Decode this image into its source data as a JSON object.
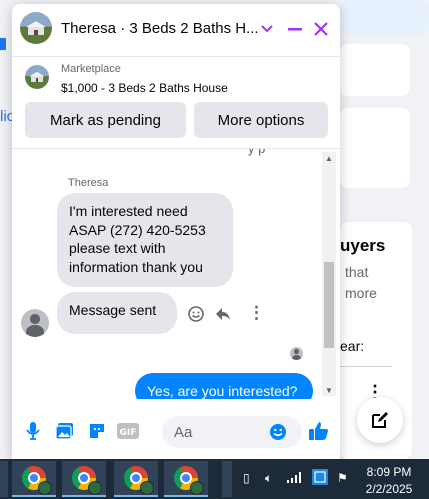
{
  "background": {
    "left_link_text": "lic",
    "right_heading": "uyers",
    "right_lines": [
      "that",
      "more"
    ],
    "right_small": "ear:",
    "colors": {
      "page_bg": "#f0f2f5",
      "link": "#1877f2"
    }
  },
  "chat": {
    "title": "Theresa · 3 Beds 2 Baths H...",
    "listing": {
      "label": "Marketplace",
      "price_title": "$1,000 - 3 Beds 2 Baths House"
    },
    "buttons": {
      "mark_pending": "Mark as pending",
      "more_options": "More options"
    },
    "partial_text": "y p",
    "messages": [
      {
        "sender": "Theresa",
        "text": "I'm interested  need ASAP (272) 420-5253 please text with information thank you"
      },
      {
        "text": "Message sent"
      },
      {
        "text": "Yes, are you interested?"
      }
    ],
    "composer": {
      "placeholder": "Aa",
      "value": ""
    },
    "colors": {
      "accent": "#a033ff",
      "outgoing_bubble": "#0084ff",
      "incoming_bubble": "#e4e6eb"
    }
  },
  "taskbar": {
    "apps": [
      "chrome",
      "chrome",
      "chrome",
      "chrome"
    ],
    "time": "8:09 PM",
    "date": "2/2/2025"
  }
}
